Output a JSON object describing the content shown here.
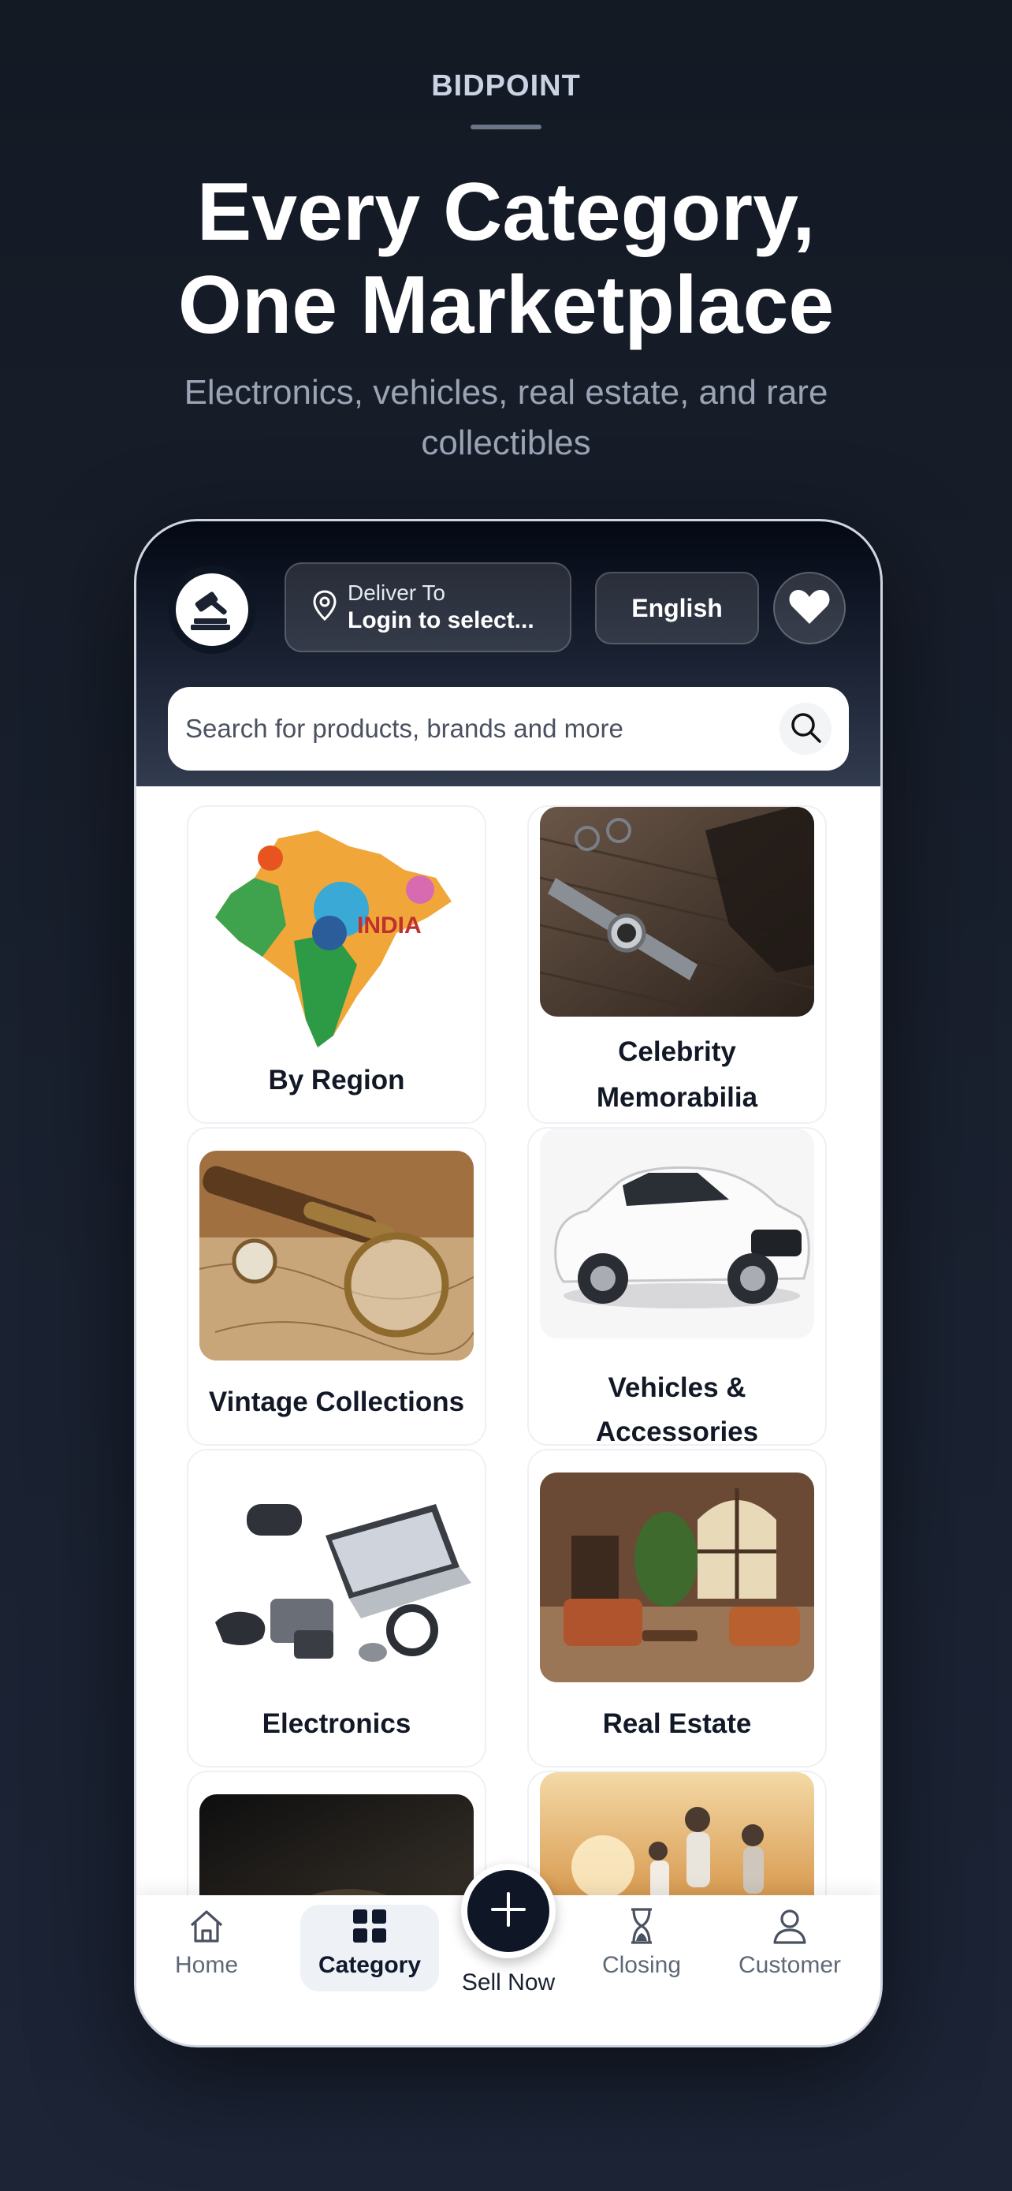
{
  "brand": "BIDPOINT",
  "headline_line1": "Every Category,",
  "headline_line2": "One Marketplace",
  "subhead": "Electronics, vehicles, real estate, and rare collectibles",
  "header": {
    "deliver_label": "Deliver To",
    "deliver_value": "Login to select...",
    "language": "English"
  },
  "search": {
    "placeholder": "Search for products, brands and more"
  },
  "categories": [
    {
      "label": "By Region"
    },
    {
      "label_line1": "Celebrity",
      "label_line2": "Memorabilia"
    },
    {
      "label": "Vintage Collections"
    },
    {
      "label_line1": "Vehicles &",
      "label_line2": "Accessories"
    },
    {
      "label": "Electronics"
    },
    {
      "label": "Real Estate"
    }
  ],
  "tabbar": {
    "home": "Home",
    "category": "Category",
    "sell_now": "Sell Now",
    "closing": "Closing",
    "customer": "Customer",
    "active": "Category"
  },
  "colors": {
    "accent_dark": "#0f1625",
    "background": "#141a24"
  }
}
